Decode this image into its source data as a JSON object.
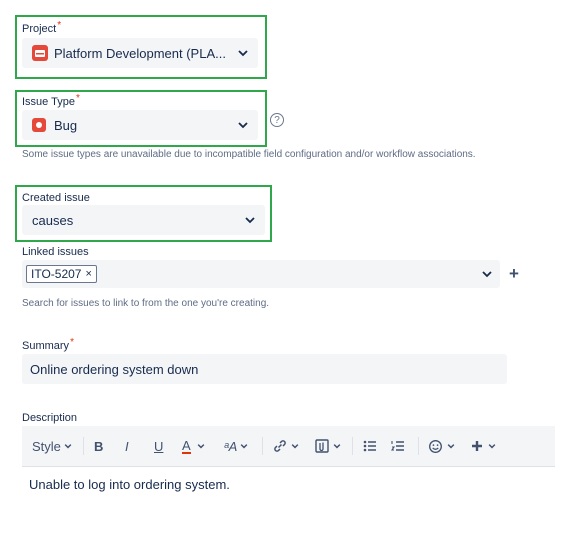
{
  "project": {
    "label": "Project",
    "required_mark": "*",
    "value": "Platform Development (PLA..."
  },
  "issue_type": {
    "label": "Issue Type",
    "required_mark": "*",
    "value": "Bug",
    "help_icon": "?",
    "help_text": "Some issue types are unavailable due to incompatible field configuration and/or workflow associations."
  },
  "created_issue": {
    "label": "Created issue",
    "value": "causes"
  },
  "linked_issues": {
    "label": "Linked issues",
    "tag": "ITO-5207",
    "tag_remove": "×",
    "add_icon": "+",
    "help_text": "Search for issues to link to from the one you're creating."
  },
  "summary": {
    "label": "Summary",
    "required_mark": "*",
    "value": "Online ordering system down"
  },
  "description": {
    "label": "Description",
    "toolbar": {
      "style_label": "Style",
      "bold": "B",
      "italic": "I",
      "underline": "U",
      "text_color": "A",
      "more_formatting": "ᵃA"
    },
    "value": "Unable to log into ordering system."
  },
  "colors": {
    "highlight": "#2ea84a",
    "required": "#de350b",
    "bug": "#e5493a",
    "field_bg": "#f4f5f7"
  }
}
